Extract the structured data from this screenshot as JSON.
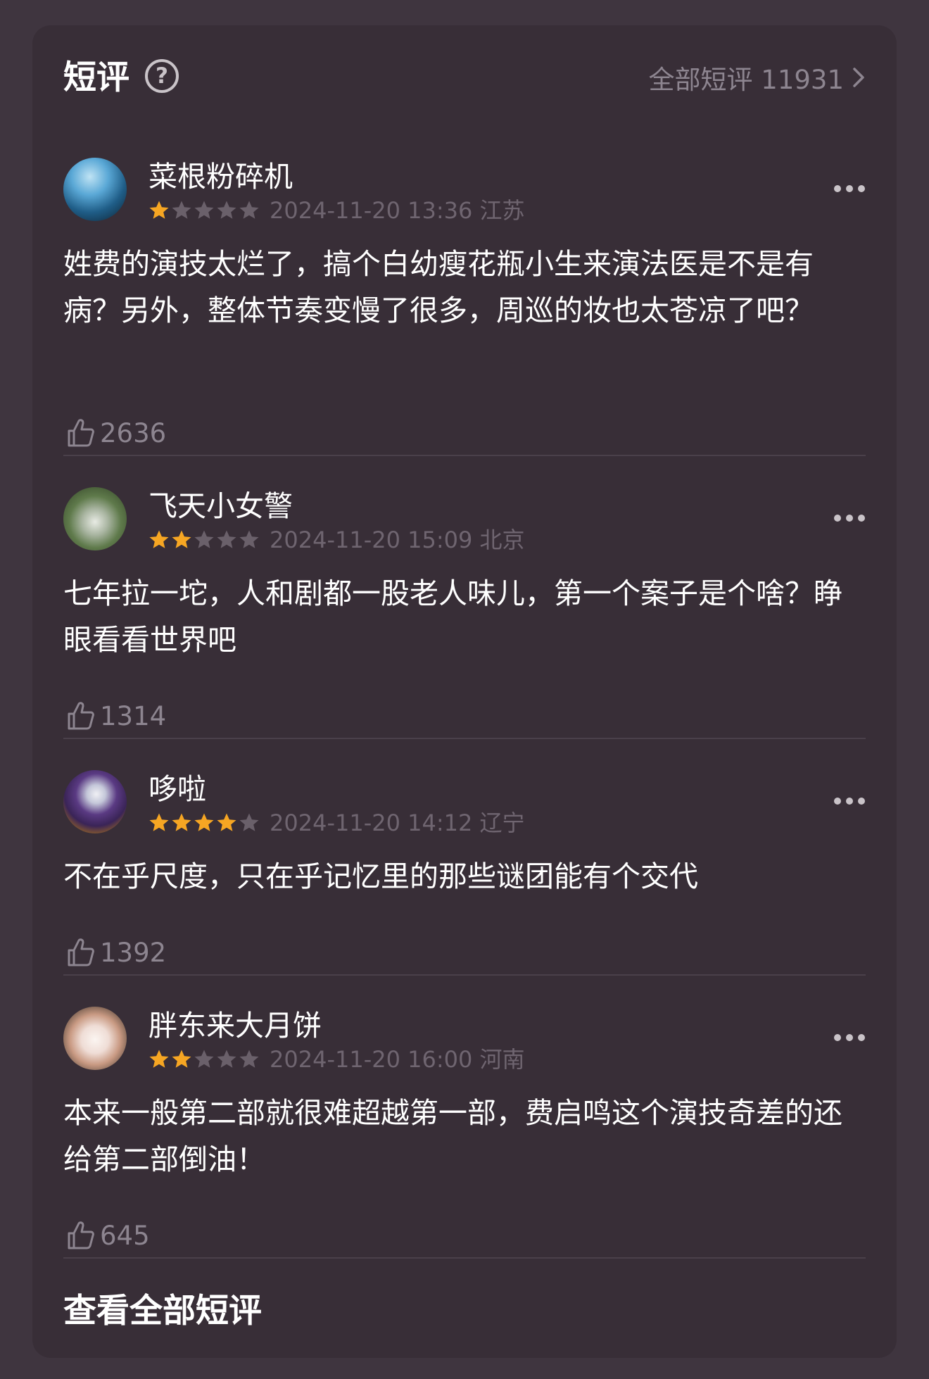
{
  "header": {
    "title": "短评",
    "help_icon": "question-circle-icon",
    "all_link_label": "全部短评 11931"
  },
  "colors": {
    "background": "#3f353f",
    "card": "#382e37",
    "star_filled": "#f6a623",
    "star_empty": "#6a606a",
    "muted_text": "#8d8590"
  },
  "reviews": [
    {
      "username": "菜根粉碎机",
      "rating": 1,
      "meta": "2024-11-20 13:36 江苏",
      "comment": "姓费的演技太烂了，搞个白幼瘦花瓶小生来演法医是不是有病？另外，整体节奏变慢了很多，周巡的妆也太苍凉了吧？",
      "likes": "2636"
    },
    {
      "username": "飞天小女警",
      "rating": 2,
      "meta": "2024-11-20 15:09 北京",
      "comment": "七年拉一坨，人和剧都一股老人味儿，第一个案子是个啥？睁眼看看世界吧",
      "likes": "1314"
    },
    {
      "username": "哆啦",
      "rating": 4,
      "meta": "2024-11-20 14:12 辽宁",
      "comment": "不在乎尺度，只在乎记忆里的那些谜团能有个交代",
      "likes": "1392"
    },
    {
      "username": "胖东来大月饼",
      "rating": 2,
      "meta": "2024-11-20 16:00 河南",
      "comment": "本来一般第二部就很难超越第一部，费启鸣这个演技奇差的还给第二部倒油！",
      "likes": "645"
    }
  ],
  "footer": {
    "view_all_label": "查看全部短评"
  }
}
